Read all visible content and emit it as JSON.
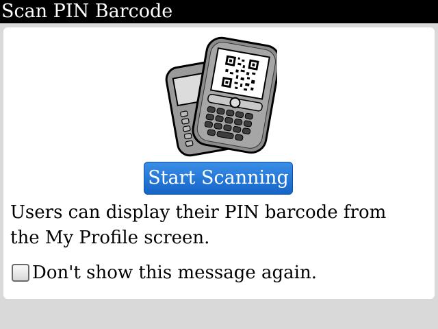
{
  "title": "Scan PIN Barcode",
  "illustration": {
    "icon": "smartphone-qr-code-icon"
  },
  "start_button": {
    "label": "Start Scanning"
  },
  "message": "Users can display their PIN barcode from the My Profile screen.",
  "checkbox": {
    "label": "Don't show this message again.",
    "checked": false
  },
  "colors": {
    "title_bar": "#000000",
    "button": "#1f78d8",
    "background": "#d9d9d9",
    "panel": "#ffffff"
  }
}
